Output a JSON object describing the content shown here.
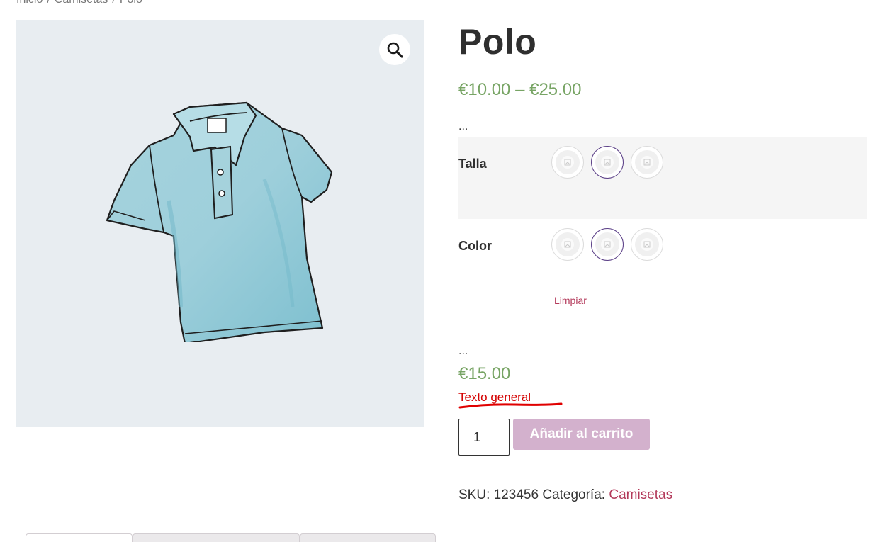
{
  "breadcrumb": {
    "items": [
      "Inicio",
      "Camisetas",
      "Polo"
    ],
    "separator": "/"
  },
  "product": {
    "title": "Polo",
    "price_range": "€10.00 – €25.00",
    "ellipsis_top": "...",
    "ellipsis_bottom": "...",
    "variation_price": "€15.00",
    "general_text": "Texto general",
    "quantity": "1",
    "add_to_cart_label": "Añadir al carrito",
    "sku_label": "SKU:",
    "sku_value": "123456",
    "category_label": "Categoría:",
    "category_value": "Camisetas"
  },
  "variations": {
    "talla": {
      "label": "Talla",
      "swatch_count": 3,
      "selected_index": 1
    },
    "color": {
      "label": "Color",
      "swatch_count": 3,
      "selected_index": 1
    },
    "clear_label": "Limpiar"
  },
  "colors": {
    "price": "#77a464",
    "link": "#b3395a",
    "general_text": "#d40000",
    "button_bg": "#d3b1cd",
    "gallery_bg": "#e8edf1",
    "selected_swatch_border": "#5b3f87"
  },
  "icons": {
    "zoom": "magnifier-icon"
  },
  "tabs": {
    "count": 3
  }
}
